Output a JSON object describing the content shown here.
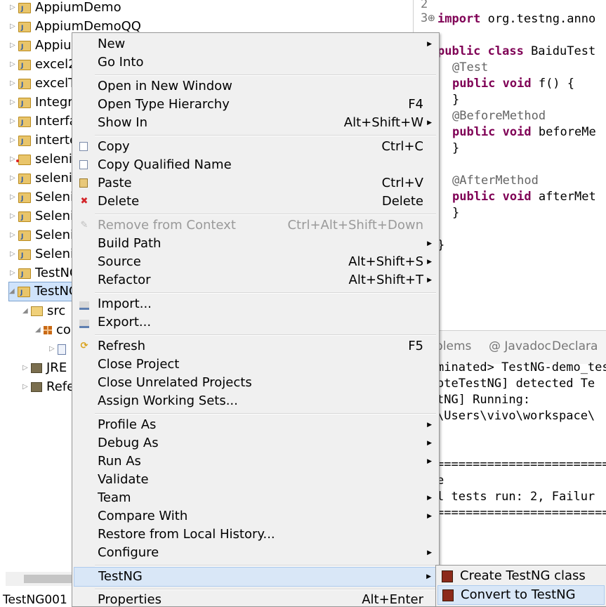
{
  "explorer": {
    "items": [
      {
        "label": "AppiumDemo"
      },
      {
        "label": "AppiumDemoQQ"
      },
      {
        "label": "Appiu"
      },
      {
        "label": "excel2"
      },
      {
        "label": "excelT"
      },
      {
        "label": "Integr"
      },
      {
        "label": "Interfa"
      },
      {
        "label": "interte"
      },
      {
        "label": "seleni"
      },
      {
        "label": "seleni"
      },
      {
        "label": "Seleni"
      },
      {
        "label": "Seleni"
      },
      {
        "label": "Seleni"
      },
      {
        "label": "Seleni"
      },
      {
        "label": "TestNG"
      },
      {
        "label": "TestNG"
      }
    ],
    "src": "src",
    "package": "co",
    "jre": "JRE",
    "refs": "Refe",
    "status_project": "TestNG001"
  },
  "editor": {
    "line_numbers": [
      "2",
      "3⊕"
    ],
    "import_kw": "import",
    "import_rest": " org.testng.anno",
    "class_kw": "public class",
    "class_name": " BaiduTest",
    "ann_test": "@Test",
    "kw_pv": "public void",
    "m_f": " f() {",
    "close_brace": "}",
    "ann_before": "@BeforeMethod",
    "m_before": " beforeMe",
    "ann_after": "@AfterMethod",
    "m_after": " afterMet"
  },
  "console": {
    "tabs": [
      "blems",
      "@ Javadoc",
      "Declara"
    ],
    "lines": [
      "minated> TestNG-demo_test",
      "oteTestNG] detected Te",
      "tNG] Running:",
      "\\Users\\vivo\\workspace\\",
      "",
      "",
      "=========================",
      "e",
      "l tests run: 2, Failur",
      "========================="
    ]
  },
  "menu": {
    "new": "New",
    "go_into": "Go Into",
    "open_new_window": "Open in New Window",
    "open_type_hierarchy": "Open Type Hierarchy",
    "open_type_hierarchy_key": "F4",
    "show_in": "Show In",
    "show_in_key": "Alt+Shift+W",
    "copy": "Copy",
    "copy_key": "Ctrl+C",
    "copy_qualified": "Copy Qualified Name",
    "paste": "Paste",
    "paste_key": "Ctrl+V",
    "delete": "Delete",
    "delete_key": "Delete",
    "remove_context": "Remove from Context",
    "remove_context_key": "Ctrl+Alt+Shift+Down",
    "build_path": "Build Path",
    "source": "Source",
    "source_key": "Alt+Shift+S",
    "refactor": "Refactor",
    "refactor_key": "Alt+Shift+T",
    "import": "Import...",
    "export": "Export...",
    "refresh": "Refresh",
    "refresh_key": "F5",
    "close_project": "Close Project",
    "close_unrelated": "Close Unrelated Projects",
    "assign_working_sets": "Assign Working Sets...",
    "profile_as": "Profile As",
    "debug_as": "Debug As",
    "run_as": "Run As",
    "validate": "Validate",
    "team": "Team",
    "compare_with": "Compare With",
    "restore_history": "Restore from Local History...",
    "configure": "Configure",
    "testng": "TestNG",
    "properties": "Properties",
    "properties_key": "Alt+Enter"
  },
  "submenu": {
    "create_class": "Create TestNG class",
    "convert": "Convert to TestNG"
  }
}
